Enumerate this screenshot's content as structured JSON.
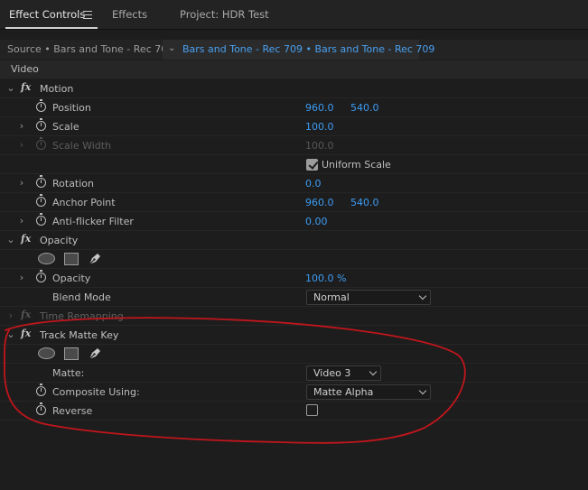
{
  "tabs": [
    {
      "label": "Effect Controls"
    },
    {
      "label": "Effects"
    },
    {
      "label": "Project: HDR Test"
    }
  ],
  "source": {
    "label": "Source • Bars and Tone - Rec 709",
    "sequence": "Bars and Tone - Rec 709 • Bars and Tone - Rec 709"
  },
  "section_title": "Video",
  "motion": {
    "name": "Motion",
    "position": {
      "label": "Position",
      "x": "960.0",
      "y": "540.0"
    },
    "scale": {
      "label": "Scale",
      "value": "100.0"
    },
    "scale_width": {
      "label": "Scale Width",
      "value": "100.0"
    },
    "uniform_scale": {
      "label": "Uniform Scale",
      "checked": true
    },
    "rotation": {
      "label": "Rotation",
      "value": "0.0"
    },
    "anchor_point": {
      "label": "Anchor Point",
      "x": "960.0",
      "y": "540.0"
    },
    "anti_flicker": {
      "label": "Anti-flicker Filter",
      "value": "0.00"
    }
  },
  "opacity": {
    "name": "Opacity",
    "opacity": {
      "label": "Opacity",
      "value": "100.0 %"
    },
    "blend_mode": {
      "label": "Blend Mode",
      "value": "Normal"
    }
  },
  "time_remapping": {
    "name": "Time Remapping"
  },
  "track_matte_key": {
    "name": "Track Matte Key",
    "matte": {
      "label": "Matte:",
      "value": "Video 3"
    },
    "composite_using": {
      "label": "Composite Using:",
      "value": "Matte Alpha"
    },
    "reverse": {
      "label": "Reverse",
      "checked": false
    }
  },
  "colors": {
    "value_blue": "#3c9cf4",
    "annotation_red": "#c0161c",
    "panel_bg": "#1d1d1d"
  }
}
